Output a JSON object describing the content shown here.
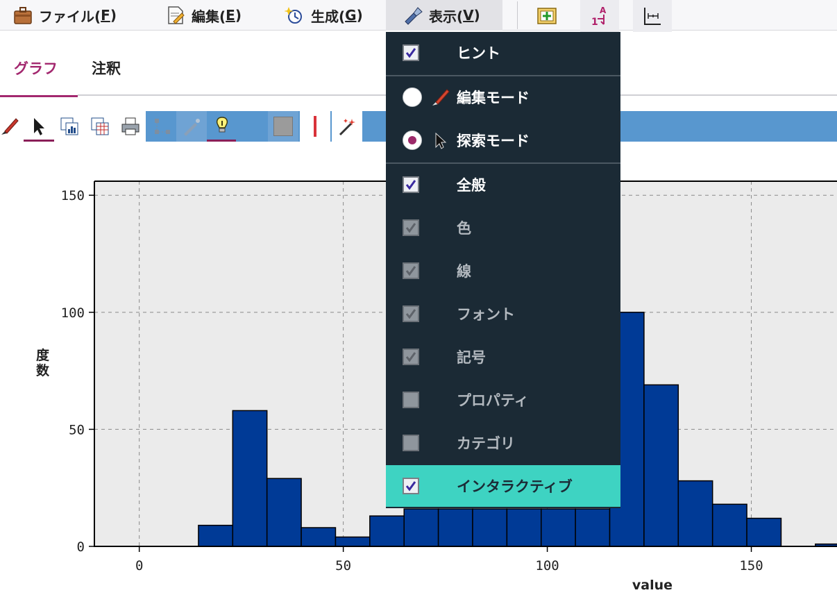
{
  "menubar": {
    "file_label": "ファイル(",
    "file_mnemonic": "F",
    "edit_label": "編集(",
    "edit_mnemonic": "E",
    "generate_label": "生成(",
    "generate_mnemonic": "G",
    "view_label": "表示(",
    "view_mnemonic": "V",
    "close_paren": ")"
  },
  "tabs": [
    {
      "label": "グラフ",
      "active": true
    },
    {
      "label": "注釈",
      "active": false
    }
  ],
  "view_menu": {
    "items": [
      {
        "label": "ヒント",
        "kind": "checkbox",
        "checked": true,
        "enabled": true
      },
      {
        "label": "編集モード",
        "kind": "radio",
        "checked": false,
        "enabled": true,
        "icon": "paintbrush-icon"
      },
      {
        "label": "探索モード",
        "kind": "radio",
        "checked": true,
        "enabled": true,
        "icon": "pointer-icon"
      },
      {
        "label": "全般",
        "kind": "checkbox",
        "checked": true,
        "enabled": true
      },
      {
        "label": "色",
        "kind": "checkbox",
        "checked": true,
        "enabled": false
      },
      {
        "label": "線",
        "kind": "checkbox",
        "checked": true,
        "enabled": false
      },
      {
        "label": "フォント",
        "kind": "checkbox",
        "checked": true,
        "enabled": false
      },
      {
        "label": "記号",
        "kind": "checkbox",
        "checked": true,
        "enabled": false
      },
      {
        "label": "プロパティ",
        "kind": "checkbox",
        "checked": false,
        "enabled": false
      },
      {
        "label": "カテゴリ",
        "kind": "checkbox",
        "checked": false,
        "enabled": false
      },
      {
        "label": "インタラクティブ",
        "kind": "checkbox",
        "checked": true,
        "enabled": true,
        "highlighted": true
      }
    ]
  },
  "colors": {
    "accent": "#a3286f",
    "menu_bg": "#1b2a35",
    "menu_highlight": "#3ed3c2",
    "toolbar_blue": "#5897cf",
    "bar_fill": "#003a96",
    "plot_bg": "#ebebeb"
  },
  "chart_data": {
    "type": "bar",
    "title": "",
    "xlabel": "value",
    "ylabel": "度数",
    "xlim": [
      -11,
      171
    ],
    "ylim": [
      0,
      156
    ],
    "xticks": [
      0,
      50,
      100,
      150
    ],
    "yticks": [
      0,
      50,
      100,
      150
    ],
    "grid": true,
    "bin_width": 8.4,
    "bins": [
      {
        "x0": 14.5,
        "count": 9
      },
      {
        "x0": 22.9,
        "count": 58
      },
      {
        "x0": 31.3,
        "count": 29
      },
      {
        "x0": 39.7,
        "count": 8
      },
      {
        "x0": 48.1,
        "count": 4
      },
      {
        "x0": 56.5,
        "count": 13
      },
      {
        "x0": 64.9,
        "count": 16
      },
      {
        "x0": 73.3,
        "count": 16
      },
      {
        "x0": 81.7,
        "count": 16
      },
      {
        "x0": 90.1,
        "count": 16
      },
      {
        "x0": 98.5,
        "count": 16
      },
      {
        "x0": 106.9,
        "count": 16
      },
      {
        "x0": 115.3,
        "count": 100
      },
      {
        "x0": 123.7,
        "count": 69
      },
      {
        "x0": 132.1,
        "count": 28
      },
      {
        "x0": 140.5,
        "count": 18
      },
      {
        "x0": 148.9,
        "count": 12
      },
      {
        "x0": 165.7,
        "count": 1
      }
    ]
  }
}
